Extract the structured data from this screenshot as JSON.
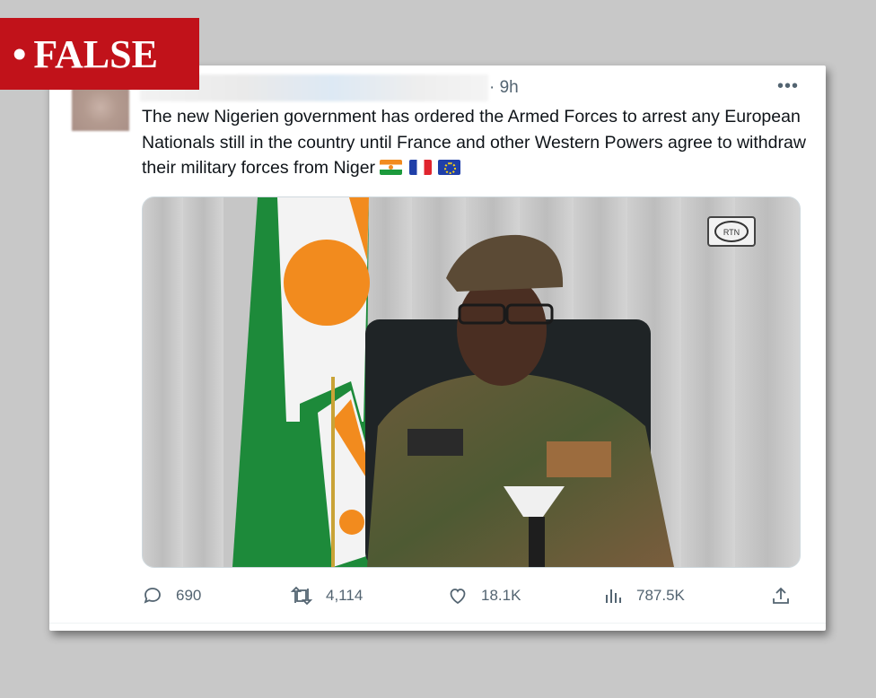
{
  "verdict": {
    "dot": "•",
    "label": "FALSE"
  },
  "tweet": {
    "time": "· 9h",
    "more_icon": "more-icon",
    "text": "The new Nigerien government has ordered the Armed Forces to arrest any European Nationals still in the country until France and other Western Powers agree to withdraw their military forces from Niger",
    "flags": [
      "niger-flag",
      "france-flag",
      "eu-flag"
    ]
  },
  "media": {
    "description_icon": "video-still",
    "channel_logo": "RTN"
  },
  "stats": {
    "replies": "690",
    "retweets": "4,114",
    "likes": "18.1K",
    "views": "787.5K"
  },
  "colors": {
    "verdict_bg": "#c1121a",
    "text": "#0f1419",
    "muted": "#536471"
  }
}
